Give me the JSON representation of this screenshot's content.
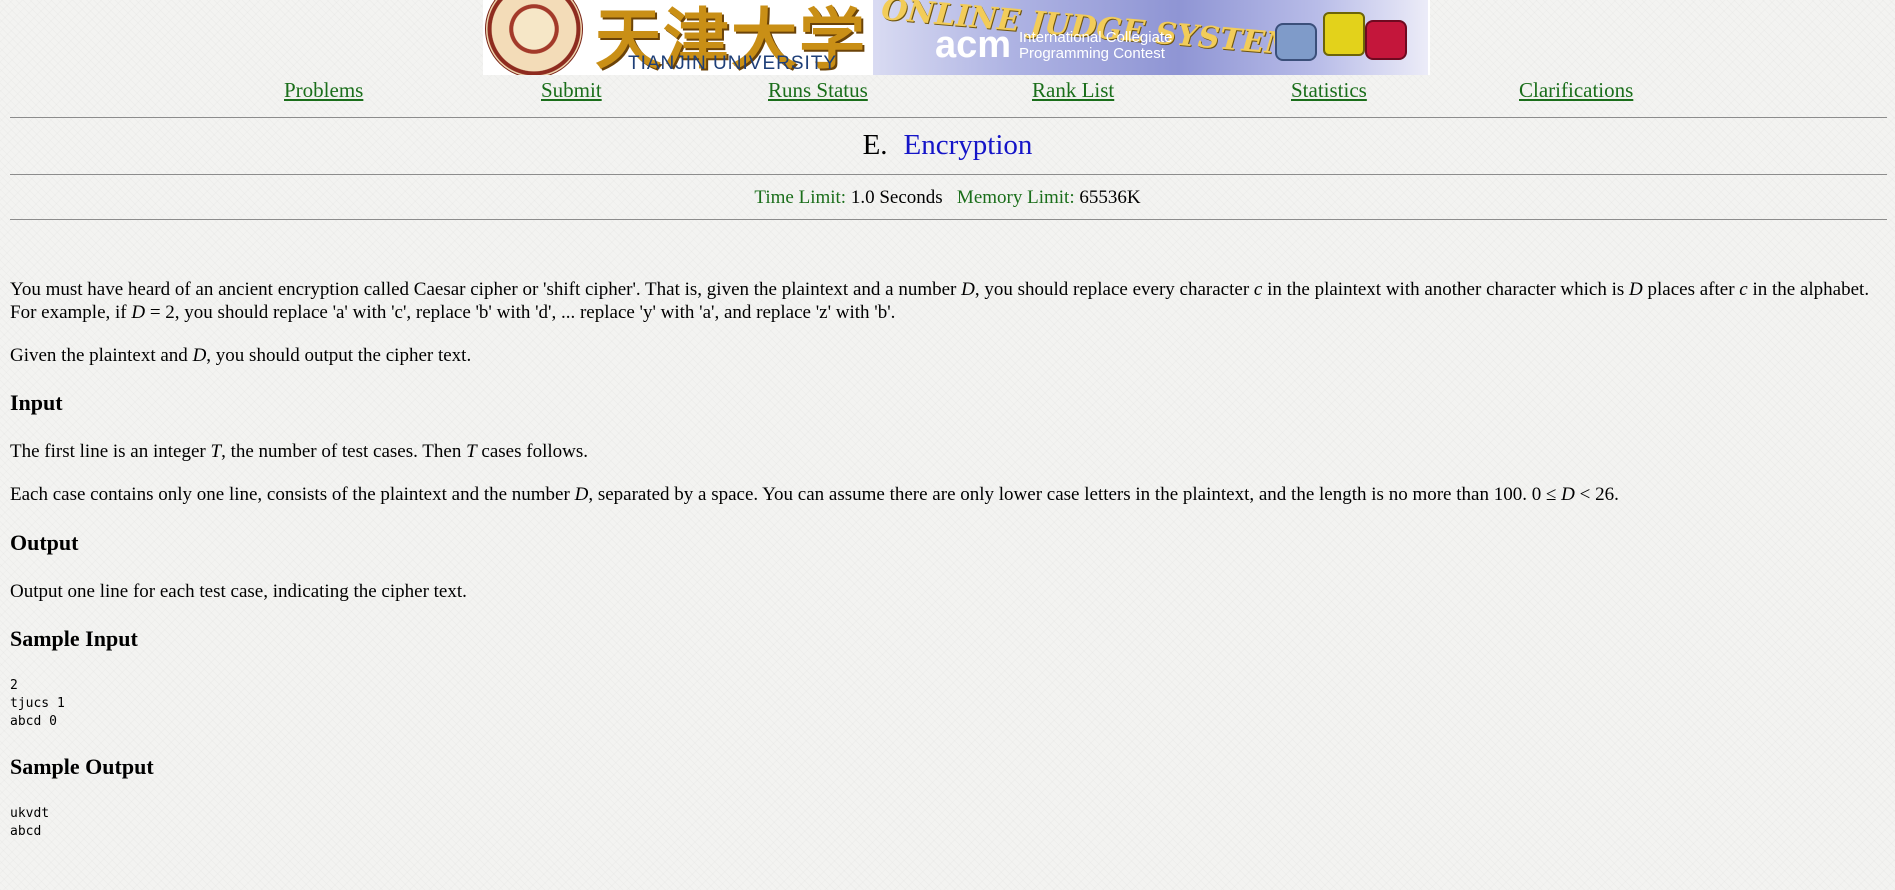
{
  "banner": {
    "chinese_name": "天津大学",
    "university": "TIANJIN UNIVERSITY",
    "oj_title": "ONLINE JUDGE SYSTEM",
    "acm": "acm",
    "icpc_line1": "International Collegiate",
    "icpc_line2": "Programming Contest"
  },
  "nav": {
    "problems": "Problems",
    "submit": "Submit",
    "runs_status": "Runs Status",
    "rank_list": "Rank List",
    "statistics": "Statistics",
    "clarifications": "Clarifications"
  },
  "problem": {
    "id": "E.",
    "name": "Encryption",
    "time_limit_label": "Time Limit:",
    "time_limit_value": "1.0 Seconds",
    "memory_limit_label": "Memory Limit:",
    "memory_limit_value": "65536K"
  },
  "description": {
    "p1_part1": "You must have heard of an ancient encryption called Caesar cipher or 'shift cipher'. That is, given the plaintext and a number ",
    "p1_var_d": "D",
    "p1_part2": ", you should replace every character ",
    "p1_var_c": "c",
    "p1_part3": " in the plaintext with another character which is ",
    "p1_var_d2": "D",
    "p1_part4": " places after ",
    "p1_var_c2": "c",
    "p1_part5": " in the alphabet. For example, if ",
    "p1_var_d3": "D",
    "p1_part6": " = 2, you should replace 'a' with 'c', replace 'b' with 'd', ... replace 'y' with 'a', and replace 'z' with 'b'.",
    "p2_part1": "Given the plaintext and ",
    "p2_var_d": "D",
    "p2_part2": ", you should output the cipher text."
  },
  "input": {
    "heading": "Input",
    "p1_part1": "The first line is an integer ",
    "p1_var_t": "T",
    "p1_part2": ", the number of test cases. Then ",
    "p1_var_t2": "T",
    "p1_part3": " cases follows.",
    "p2_part1": "Each case contains only one line, consists of the plaintext and the number ",
    "p2_var_d": "D",
    "p2_part2": ", separated by a space. You can assume there are only lower case letters in the plaintext, and the length is no more than 100. 0 ≤ ",
    "p2_var_d2": "D",
    "p2_part3": " < 26."
  },
  "output": {
    "heading": "Output",
    "text": "Output one line for each test case, indicating the cipher text."
  },
  "sample_input": {
    "heading": "Sample Input",
    "text": "2\ntjucs 1\nabcd 0"
  },
  "sample_output": {
    "heading": "Sample Output",
    "text": "ukvdt\nabcd"
  },
  "colors": {
    "nav_link": "#1a6e1a",
    "problem_name": "#1515c8",
    "limit_label": "#1a6e1a"
  }
}
